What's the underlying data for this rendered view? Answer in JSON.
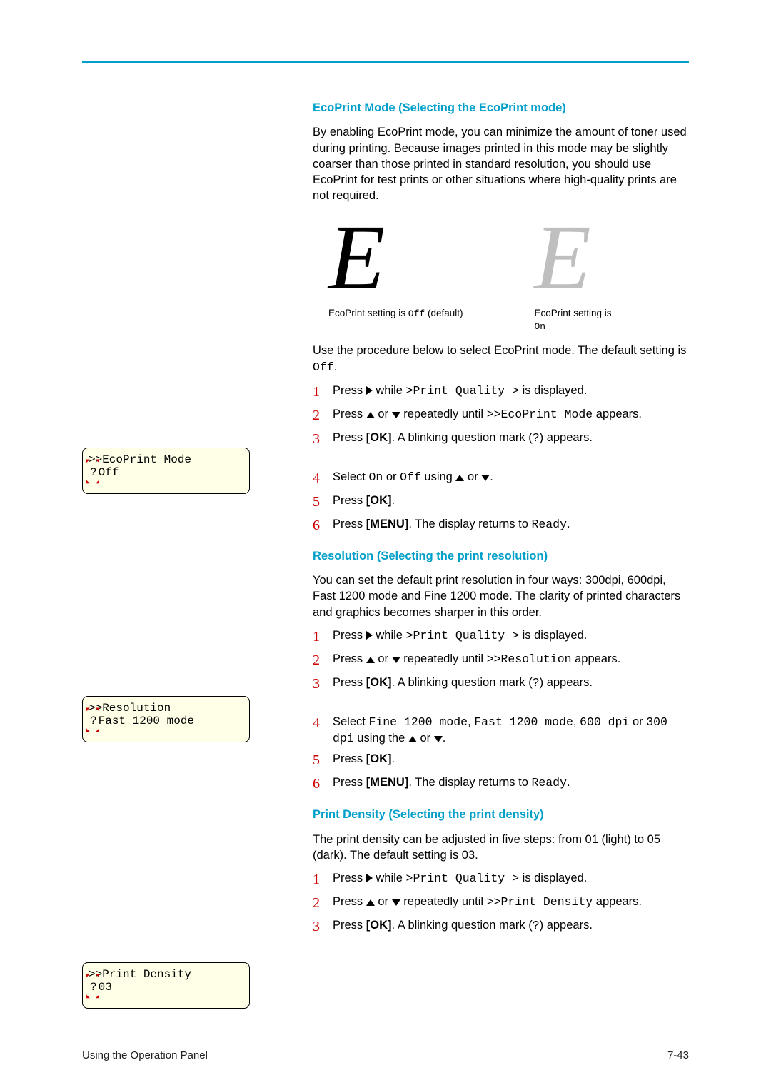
{
  "footer": {
    "left": "Using the Operation Panel",
    "right": "7-43"
  },
  "s1": {
    "heading": "EcoPrint Mode (Selecting the EcoPrint mode)",
    "intro": "By enabling EcoPrint mode, you can minimize the amount of toner used during printing. Because images printed in this mode may be slightly coarser than those printed in standard resolution, you should use EcoPrint for test prints or other situations where high-quality prints are not required.",
    "cap1a": "EcoPrint setting is ",
    "cap1b": "Off",
    "cap1c": " (default)",
    "cap2a": "EcoPrint setting is ",
    "cap2b": "On",
    "para2a": "Use the procedure below to select EcoPrint mode. The default setting is ",
    "para2b": "Off",
    "para2c": ".",
    "n1": "1",
    "n2": "2",
    "n3": "3",
    "n4": "4",
    "n5": "5",
    "n6": "6",
    "t1a": "Press ",
    "t1b": " while ",
    "t1c": ">Print Quality >",
    "t1d": " is displayed.",
    "t2a": "Press ",
    "t2b": " or ",
    "t2c": " repeatedly until ",
    "t2d": ">>EcoPrint Mode",
    "t2e": " appears.",
    "t3a": "Press ",
    "t3b": "[OK]",
    "t3c": ". A blinking question mark (",
    "t3d": "?",
    "t3e": ") appears.",
    "t4a": "Select ",
    "t4b": "On",
    "t4c": " or ",
    "t4d": "Off",
    "t4e": " using ",
    "t4f": " or ",
    "t4g": ".",
    "t5a": "Press ",
    "t5b": "[OK]",
    "t5c": ".",
    "t6a": "Press ",
    "t6b": "[MENU]",
    "t6c": ". The display returns to ",
    "t6d": "Ready",
    "t6e": ".",
    "disp1": ">>EcoPrint Mode",
    "disp2a": "?",
    "disp2b": " Off"
  },
  "s2": {
    "heading": "Resolution (Selecting the print resolution)",
    "intro": "You can set the default print resolution in four ways: 300dpi, 600dpi, Fast 1200 mode and Fine 1200 mode. The clarity of printed characters and graphics becomes sharper in this order.",
    "n1": "1",
    "n2": "2",
    "n3": "3",
    "n4": "4",
    "n5": "5",
    "n6": "6",
    "t1a": "Press ",
    "t1b": " while ",
    "t1c": ">Print Quality >",
    "t1d": " is displayed.",
    "t2a": "Press ",
    "t2b": " or ",
    "t2c": " repeatedly until ",
    "t2d": ">>Resolution",
    "t2e": " appears.",
    "t3a": "Press ",
    "t3b": "[OK]",
    "t3c": ". A blinking question mark (",
    "t3d": "?",
    "t3e": ") appears.",
    "t4a": "Select ",
    "t4b": "Fine 1200 mode",
    "t4c": ", ",
    "t4d": "Fast 1200 mode",
    "t4e": ", ",
    "t4f": "600 dpi",
    "t4g": " or ",
    "t4h": "300 dpi",
    "t4i": " using the ",
    "t4j": " or ",
    "t4k": ".",
    "t5a": "Press ",
    "t5b": "[OK]",
    "t5c": ".",
    "t6a": "Press ",
    "t6b": "[MENU]",
    "t6c": ". The display returns to ",
    "t6d": "Ready",
    "t6e": ".",
    "disp1": ">>Resolution",
    "disp2a": "?",
    "disp2b": " Fast 1200 mode"
  },
  "s3": {
    "heading": "Print Density (Selecting the print density)",
    "intro": "The print density can be adjusted in five steps: from 01 (light) to 05 (dark). The default setting is 03.",
    "n1": "1",
    "n2": "2",
    "n3": "3",
    "t1a": "Press ",
    "t1b": " while ",
    "t1c": ">Print Quality >",
    "t1d": " is displayed.",
    "t2a": "Press ",
    "t2b": " or ",
    "t2c": " repeatedly until ",
    "t2d": ">>Print Density",
    "t2e": " appears.",
    "t3a": "Press ",
    "t3b": "[OK]",
    "t3c": ". A blinking question mark (",
    "t3d": "?",
    "t3e": ") appears.",
    "disp1": ">>Print Density",
    "disp2a": "?",
    "disp2b": " 03"
  }
}
